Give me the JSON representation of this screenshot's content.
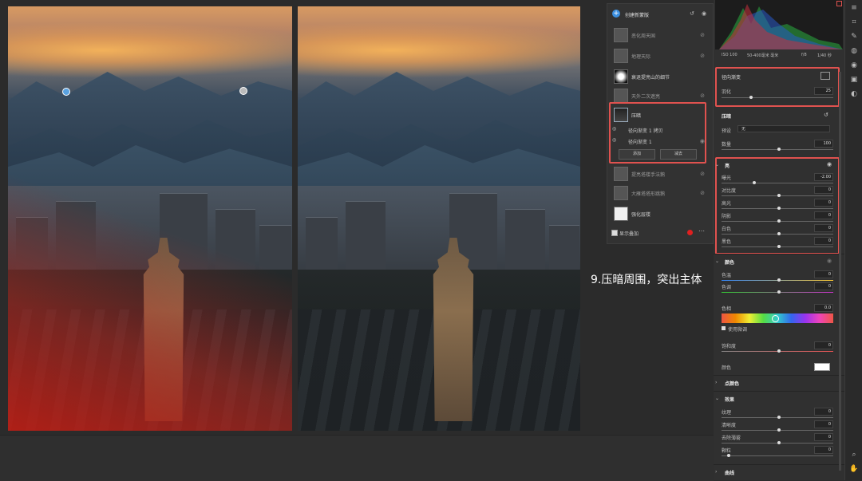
{
  "caption": "9.压暗周围，突出主体",
  "masks_panel": {
    "create_label": "创建新蒙版",
    "items": [
      {
        "label": "恶化周天国"
      },
      {
        "label": "地理天际"
      },
      {
        "label": "衰退提亮山的细节"
      },
      {
        "label": "天外二次遮亮"
      },
      {
        "label": "压暗"
      },
      {
        "label": "径向渐变 1 拷贝"
      },
      {
        "label": "径向渐变 1"
      },
      {
        "label": "提亮塔楼手法鹅"
      },
      {
        "label": "大雁塔塔形跳鹅"
      },
      {
        "label": "强化层楼"
      }
    ],
    "add_button": "添加",
    "subtract_button": "减去",
    "show_overlay": "显示叠加"
  },
  "histogram_info": {
    "iso": "ISO 100",
    "lens": "50-400毫米 毫米",
    "aperture": "f/8",
    "shutter": "1/40 秒"
  },
  "radial": {
    "title": "径向渐变",
    "feather_label": "羽化",
    "feather_value": "25"
  },
  "darken": {
    "title": "压暗",
    "preset_label": "预设",
    "preset_value": "无",
    "amount_label": "数量",
    "amount_value": "100"
  },
  "light": {
    "title": "亮",
    "rows": [
      {
        "label": "曝光",
        "value": "-2.00"
      },
      {
        "label": "对比度",
        "value": "0"
      },
      {
        "label": "高光",
        "value": "0"
      },
      {
        "label": "阴影",
        "value": "0"
      },
      {
        "label": "白色",
        "value": "0"
      },
      {
        "label": "黑色",
        "value": "0"
      }
    ]
  },
  "color": {
    "title": "颜色",
    "temp_label": "色温",
    "temp_value": "0",
    "tint_label": "色调",
    "tint_value": "0",
    "hue_label": "色相",
    "hue_value": "0.0",
    "fine_label": "使用微调",
    "sat_label": "饱和度",
    "sat_value": "0",
    "color_label": "颜色"
  },
  "point_color": {
    "title": "点颜色"
  },
  "effects": {
    "title": "效果",
    "rows": [
      {
        "label": "纹理",
        "value": "0"
      },
      {
        "label": "清晰度",
        "value": "0"
      },
      {
        "label": "去除薄雾",
        "value": "0"
      },
      {
        "label": "颗粒",
        "value": "0"
      }
    ]
  },
  "curves": {
    "title": "曲线"
  },
  "colors": {
    "accent_red": "#e0524f",
    "panel_bg": "#303030"
  }
}
